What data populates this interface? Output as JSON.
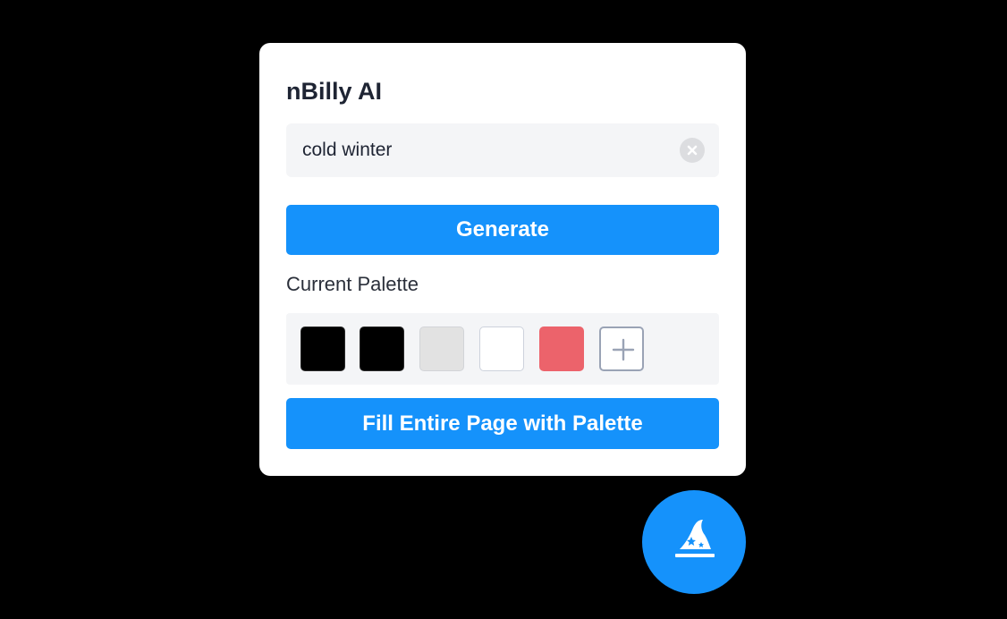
{
  "panel": {
    "title": "nBilly AI",
    "search": {
      "value": "cold winter",
      "clear_icon": "close-circle-icon"
    },
    "generate_label": "Generate",
    "palette_label": "Current Palette",
    "swatches": [
      {
        "color": "#000000"
      },
      {
        "color": "#000000"
      },
      {
        "color": "#e2e2e2"
      },
      {
        "color": "#ffffff"
      },
      {
        "color": "#ec636b"
      }
    ],
    "add_swatch_icon": "plus-icon",
    "fill_label": "Fill Entire Page with Palette"
  },
  "fab": {
    "icon": "wizard-hat-icon"
  },
  "colors": {
    "accent": "#1592fb",
    "background": "#000000",
    "panel": "#ffffff",
    "field": "#f4f5f7",
    "text": "#1e2433"
  }
}
